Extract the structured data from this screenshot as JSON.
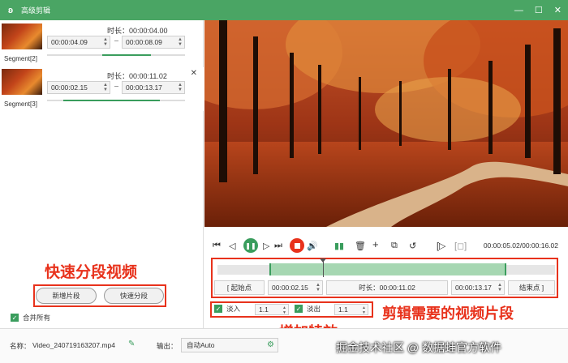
{
  "window": {
    "title": "高级剪辑",
    "app_icon": "rabbit-logo",
    "controls": [
      "minimize-icon",
      "maximize-icon",
      "close-icon"
    ]
  },
  "segments": [
    {
      "label": "Segment[2]",
      "duration": "时长：00:00:04.00",
      "start": "00:00:04.09",
      "end": "00:00:08.09"
    },
    {
      "label": "Segment[3]",
      "duration": "时长：00:00:11.02",
      "start": "00:00:02.15",
      "end": "00:00:13.17"
    }
  ],
  "left_actions": {
    "annotation": "快速分段视频",
    "add_segment": "新增片段",
    "quick_split": "快速分段",
    "merge_all": "合并所有"
  },
  "player": {
    "time_display": "00:00:05.02/00:00:16.02"
  },
  "timeline": {
    "start_btn": "[ 起始点",
    "start_time": "00:00:02.15",
    "duration": "时长：00:00:11.02",
    "end_time": "00:00:13.17",
    "end_btn": "结束点 ]",
    "playhead_fraction": 0.37,
    "selection": [
      0.16,
      0.86
    ]
  },
  "effects": {
    "fade_in_label": "淡入",
    "fade_in_value": "1.1",
    "fade_out_label": "淡出",
    "fade_out_value": "1.1"
  },
  "annotations": {
    "clip": "剪辑需要的视频片段",
    "effect": "增加特效"
  },
  "bottom": {
    "name_label": "名称：",
    "name_value": "Video_240719163207.mp4",
    "output_label": "输出：",
    "output_value": "自动Auto",
    "watermark": "掘金技术社区 @ 数据蛙官方软件"
  },
  "colors": {
    "accent": "#4aa564",
    "annotation": "#e8321c"
  }
}
